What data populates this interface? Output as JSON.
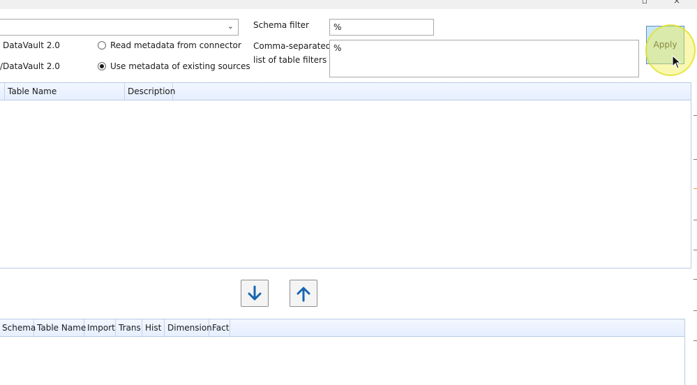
{
  "window": {
    "maximize_glyph": "▫",
    "close_glyph": "×"
  },
  "source": {
    "selected_value": "",
    "radio_labels": {
      "row1_left": "DataVault 2.0",
      "row2_left": "/DataVault 2.0"
    },
    "read_metadata_label": "Read metadata from connector",
    "use_metadata_label": "Use metadata of existing sources",
    "use_metadata_checked": true
  },
  "filters": {
    "schema_label": "Schema filter",
    "schema_value": "%",
    "tables_label_line1": "Comma-separated",
    "tables_label_line2": "list of table filters",
    "tables_value": "%"
  },
  "apply_button": {
    "label": "Apply"
  },
  "available_grid": {
    "columns": [
      "Table Name",
      "Description"
    ]
  },
  "selected_grid": {
    "columns": [
      "Schema",
      "Table Name",
      "Import",
      "Trans",
      "Hist",
      "Dimension",
      "Fact"
    ]
  },
  "colors": {
    "accent_blue": "#1565b0",
    "apply_bg": "#c8e6f5",
    "highlight": "#f0f050"
  }
}
